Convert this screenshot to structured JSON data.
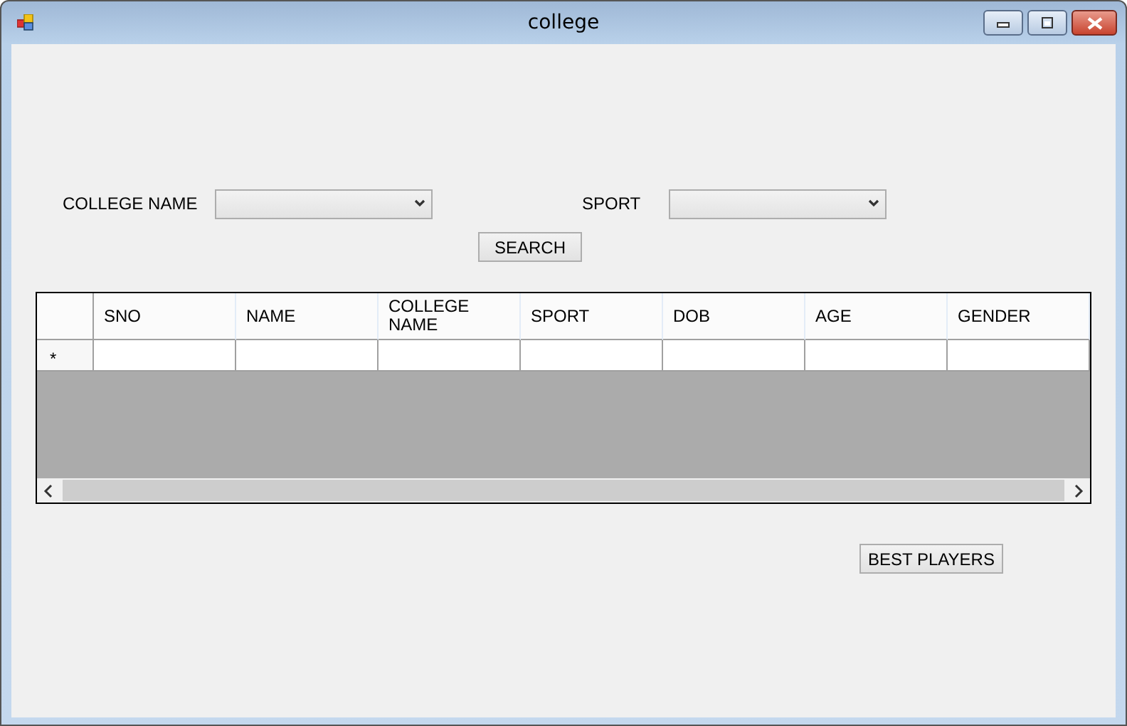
{
  "window": {
    "title": "college"
  },
  "filters": [
    {
      "label": "COLLEGE NAME"
    },
    {
      "label": "SPORT"
    }
  ],
  "search_button": "SEARCH",
  "table": {
    "columns": [
      "SNO",
      "NAME",
      "COLLEGE NAME",
      "SPORT",
      "DOB",
      "AGE",
      "GENDER"
    ],
    "new_row_marker": "*"
  },
  "best_players_button": "BEST PLAYERS"
}
